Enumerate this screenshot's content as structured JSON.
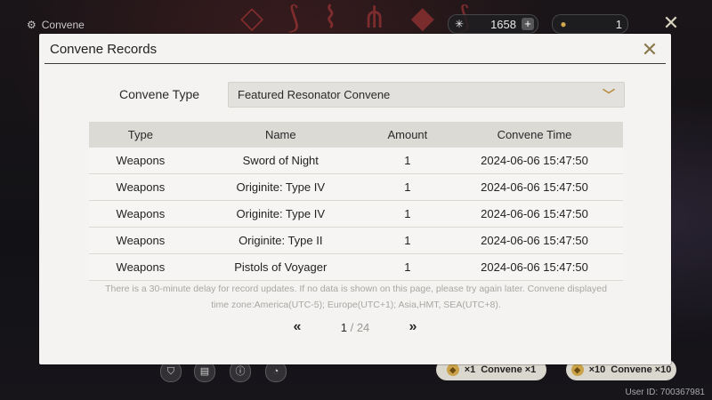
{
  "window": {
    "title": "Convene",
    "title_icon": "gear-icon"
  },
  "currencies": [
    {
      "icon": "astrite-icon",
      "value": "1658",
      "has_plus": true
    },
    {
      "icon": "tide-coin-icon",
      "value": "1",
      "has_plus": false
    }
  ],
  "dialog": {
    "title": "Convene Records",
    "convene_type_label": "Convene Type",
    "convene_type_value": "Featured Resonator Convene",
    "table": {
      "headers": [
        "Type",
        "Name",
        "Amount",
        "Convene Time"
      ],
      "rows": [
        [
          "Weapons",
          "Sword of Night",
          "1",
          "2024-06-06 15:47:50"
        ],
        [
          "Weapons",
          "Originite: Type IV",
          "1",
          "2024-06-06 15:47:50"
        ],
        [
          "Weapons",
          "Originite: Type IV",
          "1",
          "2024-06-06 15:47:50"
        ],
        [
          "Weapons",
          "Originite: Type II",
          "1",
          "2024-06-06 15:47:50"
        ],
        [
          "Weapons",
          "Pistols of Voyager",
          "1",
          "2024-06-06 15:47:50"
        ]
      ]
    },
    "notice_line1": "There is a 30-minute delay for record updates. If no data is shown on this page, please try again later. Convene displayed",
    "notice_line2": "time zone:America(UTC-5); Europe(UTC+1); Asia,HMT, SEA(UTC+8).",
    "pagination": {
      "current": "1",
      "separator": "/",
      "total": "24"
    }
  },
  "bottom": {
    "pull_one_count": "×1",
    "pull_one_label": "Convene ×1",
    "pull_ten_count": "×10",
    "pull_ten_label": "Convene ×10"
  },
  "user_id": "User ID: 700367981",
  "colors": {
    "accent": "#b88a3c",
    "dialog_bg": "#f4f3f1",
    "header_bg": "#dcdad5"
  }
}
